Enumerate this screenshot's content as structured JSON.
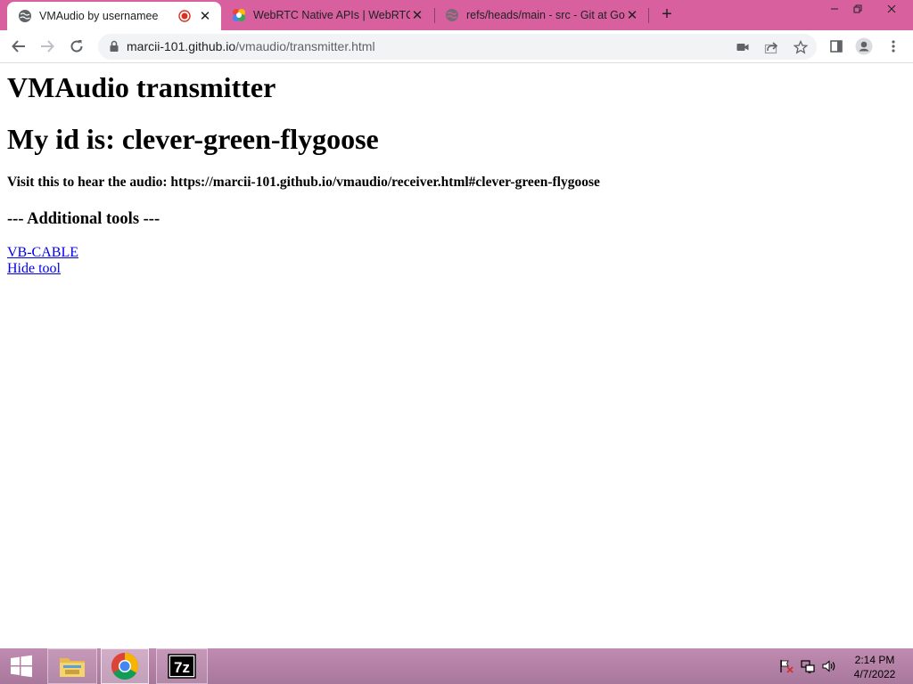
{
  "browser": {
    "tabs": [
      {
        "title": "VMAudio by usernamee",
        "favicon": "globe-icon",
        "recording": true,
        "active": true
      },
      {
        "title": "WebRTC Native APIs | WebRTC",
        "favicon": "webrtc-icon",
        "active": false
      },
      {
        "title": "refs/heads/main - src - Git at Goo",
        "favicon": "globe-icon",
        "active": false
      }
    ],
    "new_tab_label": "+",
    "address_bar": {
      "host": "marcii-101.github.io",
      "path": "/vmaudio/transmitter.html"
    },
    "colors": {
      "tabstrip": "#d9609f",
      "omnibox": "#f1f3f4"
    }
  },
  "page": {
    "title": "VMAudio transmitter",
    "id_heading": "My id is: clever-green-flygoose",
    "visit_text": "Visit this to hear the audio: https://marcii-101.github.io/vmaudio/receiver.html#clever-green-flygoose",
    "tools_heading": "--- Additional tools ---",
    "links": [
      "VB-CABLE",
      "Hide tool"
    ],
    "link_color": "#0000ee"
  },
  "taskbar": {
    "apps": [
      "start-button",
      "file-explorer",
      "chrome",
      "7-zip"
    ],
    "tray_icons": [
      "action-center-flag-icon",
      "network-icon",
      "volume-icon"
    ],
    "time": "2:14 PM",
    "date": "4/7/2022"
  }
}
